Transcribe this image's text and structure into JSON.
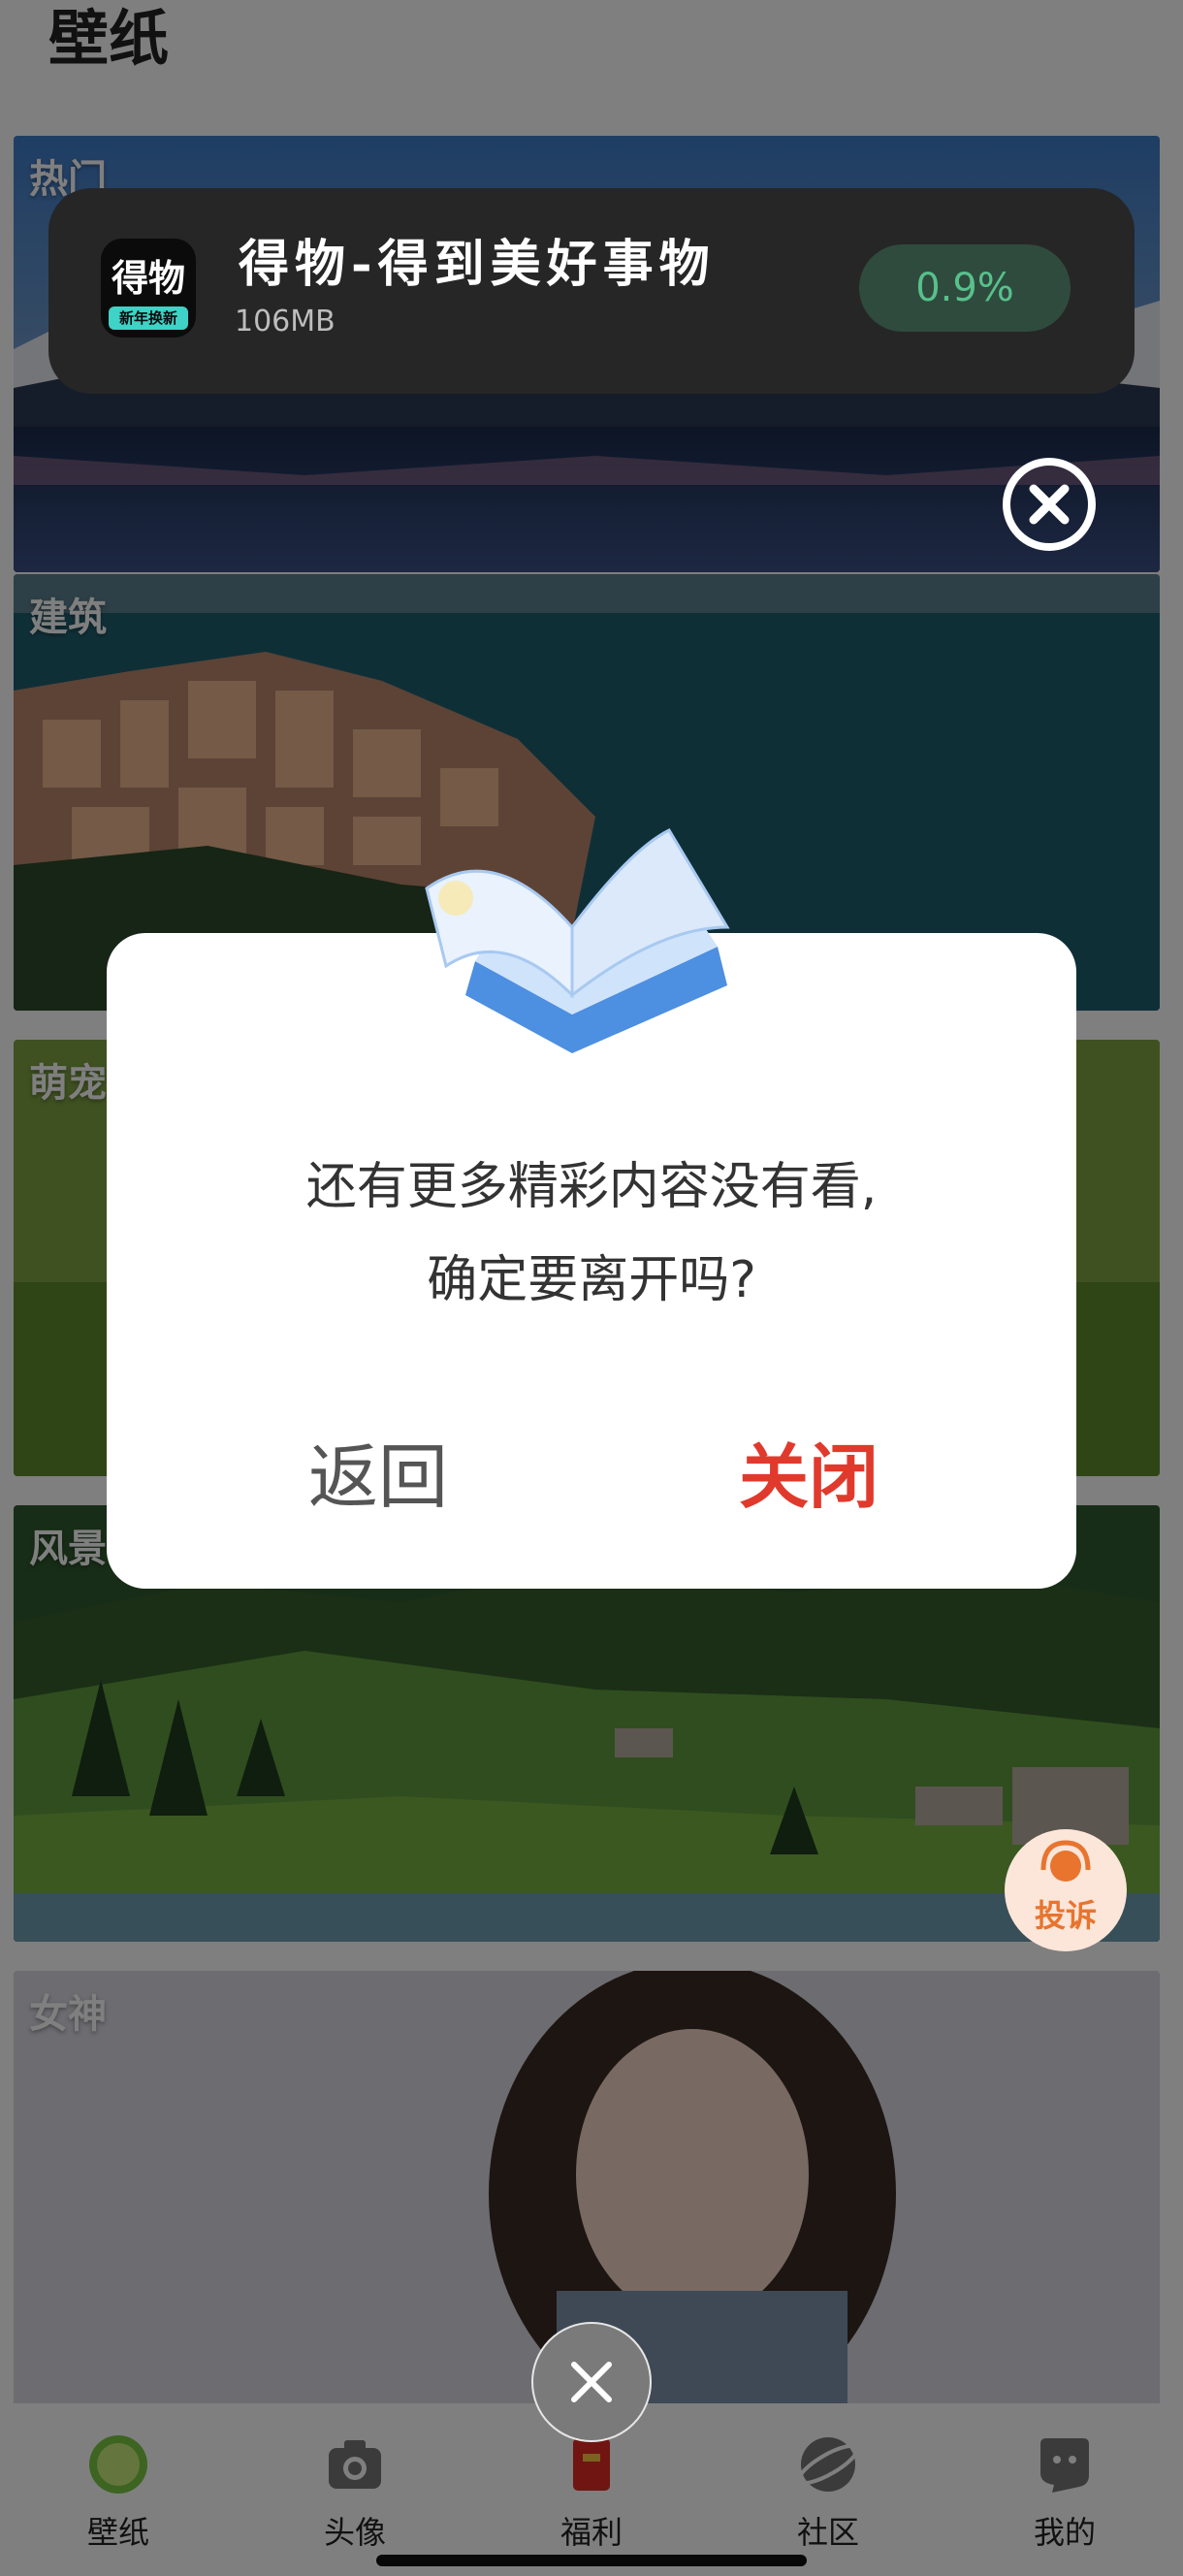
{
  "page": {
    "title": "壁纸"
  },
  "categories": [
    {
      "label": "热门"
    },
    {
      "label": "建筑"
    },
    {
      "label": "萌宠"
    },
    {
      "label": "风景"
    },
    {
      "label": "女神"
    }
  ],
  "bottom_nav": {
    "items": [
      {
        "label": "壁纸",
        "icon": "lime-icon"
      },
      {
        "label": "头像",
        "icon": "camera-icon"
      },
      {
        "label": "福利",
        "icon": "red-envelope-icon"
      },
      {
        "label": "社区",
        "icon": "planet-icon"
      },
      {
        "label": "我的",
        "icon": "profile-icon"
      }
    ]
  },
  "download_banner": {
    "app_name": "得物-得到美好事物",
    "size": "106MB",
    "progress": "0.9%",
    "icon_text": "得物",
    "icon_tag": "新年换新"
  },
  "dialog": {
    "message_line1": "还有更多精彩内容没有看,",
    "message_line2": "确定要离开吗?",
    "back_label": "返回",
    "close_label": "关闭"
  },
  "complaint": {
    "label": "投诉"
  },
  "colors": {
    "accent_red": "#e03a2d",
    "progress_green": "#58c08b",
    "complaint_orange": "#e8742e"
  }
}
